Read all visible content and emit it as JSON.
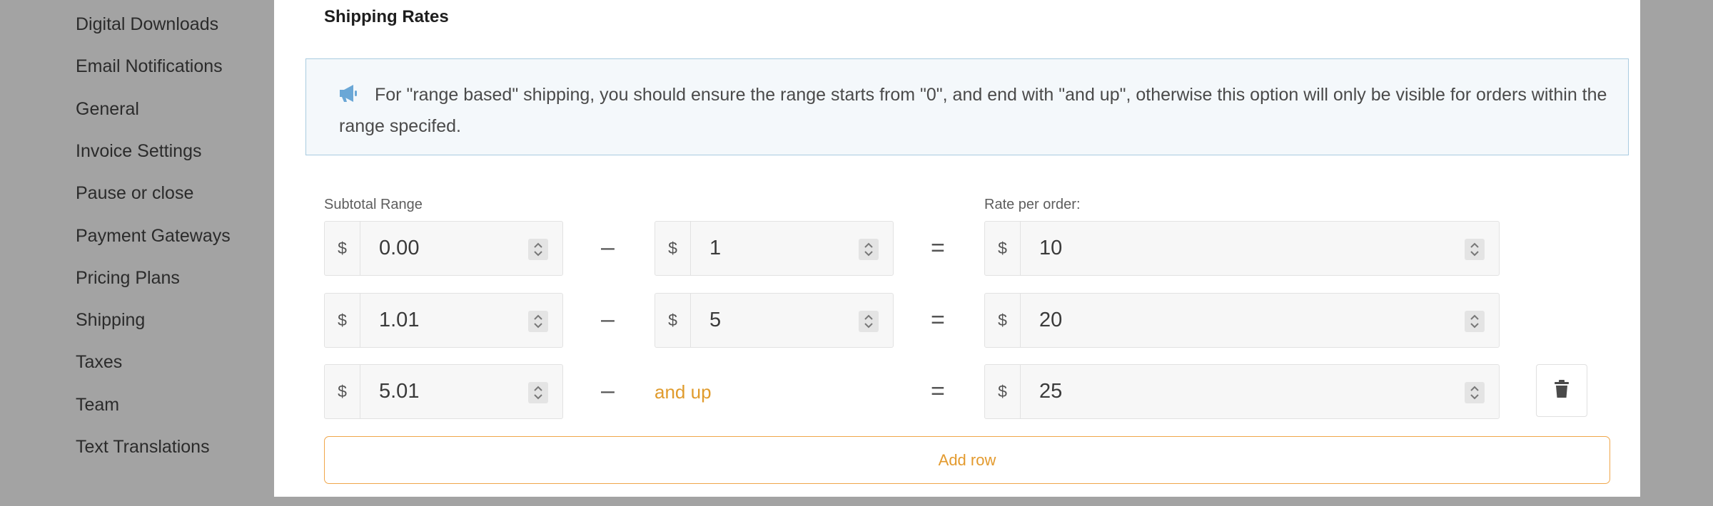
{
  "sidebar": {
    "items": [
      {
        "label": "Digital Downloads"
      },
      {
        "label": "Email Notifications"
      },
      {
        "label": "General"
      },
      {
        "label": "Invoice Settings"
      },
      {
        "label": "Pause or close"
      },
      {
        "label": "Payment Gateways"
      },
      {
        "label": "Pricing Plans"
      },
      {
        "label": "Shipping"
      },
      {
        "label": "Taxes"
      },
      {
        "label": "Team"
      },
      {
        "label": "Text Translations"
      }
    ]
  },
  "modal": {
    "title": "Shipping Rates",
    "notice": {
      "icon": "megaphone-icon",
      "text": "For \"range based\" shipping, you should ensure the range starts from \"0\", and end with \"and up\", otherwise this option will only be visible for orders within the range specifed."
    },
    "labels": {
      "subtotal_range": "Subtotal Range",
      "rate_per_order": "Rate per order:"
    },
    "currency_symbol": "$",
    "range_separator": "–",
    "equals_sign": "=",
    "rows": [
      {
        "from": "0.00",
        "to": "1",
        "rate": "10"
      },
      {
        "from": "1.01",
        "to": "5",
        "rate": "20"
      },
      {
        "from": "5.01",
        "to_label": "and up",
        "rate": "25"
      }
    ],
    "add_row_label": "Add row"
  },
  "colors": {
    "overlay": "#a3a3a3",
    "accent": "#e39a2e",
    "notice_bg": "#f4f8fb",
    "notice_border": "#a9cbe0",
    "notice_icon": "#6aa7d6"
  }
}
